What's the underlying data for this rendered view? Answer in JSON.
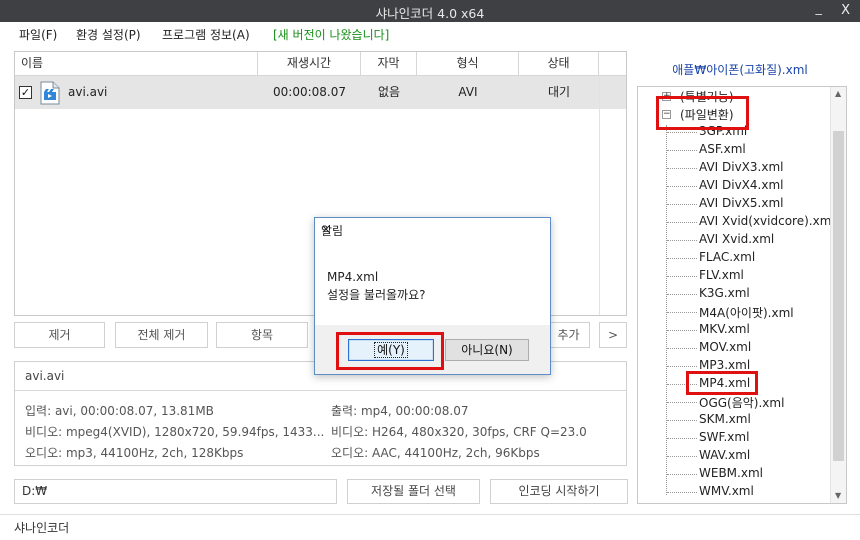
{
  "window": {
    "title": "샤나인코더 4.0 x64",
    "min_glyph": "_",
    "close_glyph": "X"
  },
  "menu": {
    "file": "파일(F)",
    "settings": "환경 설정(P)",
    "program_info": "프로그램 정보(A)",
    "update_notice": "[새 버전이 나왔습니다]"
  },
  "file_list": {
    "columns": [
      "이름",
      "재생시간",
      "자막",
      "형식",
      "상태"
    ],
    "rows": [
      {
        "checked": true,
        "check_glyph": "✓",
        "name": "avi.avi",
        "duration": "00:00:08.07",
        "subtitle": "없음",
        "format": "AVI",
        "status": "대기"
      }
    ]
  },
  "buttons": {
    "remove": "제거",
    "remove_all": "전체 제거",
    "item": "항목",
    "add_partial": "추가",
    "more": ">"
  },
  "info": {
    "filename": "avi.avi",
    "input": "입력: avi, 00:00:08.07, 13.81MB",
    "output": "출력: mp4, 00:00:08.07",
    "video_in": "비디오: mpeg4(XVID), 1280x720, 59.94fps, 1433...",
    "video_out": "비디오: H264, 480x320, 30fps, CRF Q=23.0",
    "audio_in": "오디오: mp3, 44100Hz, 2ch, 128Kbps",
    "audio_out": "오디오: AAC, 44100Hz, 2ch, 96Kbps"
  },
  "bottom": {
    "path": "D:₩",
    "select_folder": "저장될 폴더 선택",
    "start_encoding": "인코딩 시작하기"
  },
  "status": {
    "text": "샤나인코더"
  },
  "profile": {
    "title": "애플₩아이폰(고화질).xml",
    "tree": {
      "top_item": "(특별기능)",
      "top_expander": "+",
      "group": "(파일변환)",
      "group_expander": "−",
      "children": [
        "3GP.xml",
        "ASF.xml",
        "AVI DivX3.xml",
        "AVI DivX4.xml",
        "AVI DivX5.xml",
        "AVI Xvid(xvidcore).xml",
        "AVI Xvid.xml",
        "FLAC.xml",
        "FLV.xml",
        "K3G.xml",
        "M4A(아이팟).xml",
        "MKV.xml",
        "MOV.xml",
        "MP3.xml",
        "MP4.xml",
        "OGG(음악).xml",
        "SKM.xml",
        "SWF.xml",
        "WAV.xml",
        "WEBM.xml",
        "WMV.xml"
      ]
    },
    "scroll_up": "▲",
    "scroll_down": "▼"
  },
  "dialog": {
    "title": "알림",
    "close_glyph": "×",
    "line1": "MP4.xml",
    "line2": "설정을 불러올까요?",
    "yes": "예(Y)",
    "no": "아니요(N)"
  },
  "colors": {
    "highlight": "#e01010",
    "notice": "#1b8f1b",
    "profile_title": "#1a45a8",
    "titlebar": "#3f4043"
  }
}
